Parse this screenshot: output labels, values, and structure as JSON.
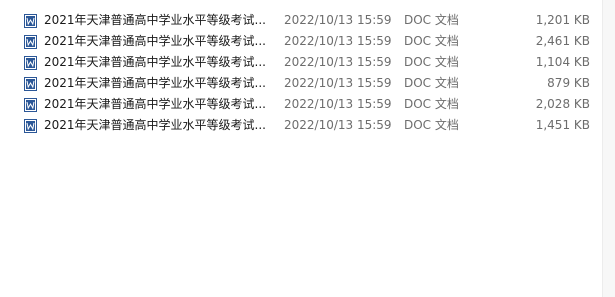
{
  "files": [
    {
      "name": "2021年天津普通高中学业水平等级考试...",
      "date": "2022/10/13 15:59",
      "type": "DOC 文档",
      "size": "1,201 KB"
    },
    {
      "name": "2021年天津普通高中学业水平等级考试...",
      "date": "2022/10/13 15:59",
      "type": "DOC 文档",
      "size": "2,461 KB"
    },
    {
      "name": "2021年天津普通高中学业水平等级考试...",
      "date": "2022/10/13 15:59",
      "type": "DOC 文档",
      "size": "1,104 KB"
    },
    {
      "name": "2021年天津普通高中学业水平等级考试...",
      "date": "2022/10/13 15:59",
      "type": "DOC 文档",
      "size": "879 KB"
    },
    {
      "name": "2021年天津普通高中学业水平等级考试...",
      "date": "2022/10/13 15:59",
      "type": "DOC 文档",
      "size": "2,028 KB"
    },
    {
      "name": "2021年天津普通高中学业水平等级考试...",
      "date": "2022/10/13 15:59",
      "type": "DOC 文档",
      "size": "1,451 KB"
    }
  ],
  "icon": "word-document-icon",
  "colors": {
    "icon_blue": "#2b5797",
    "text_primary": "#1a1a1a",
    "text_secondary": "#6d6d6d"
  }
}
